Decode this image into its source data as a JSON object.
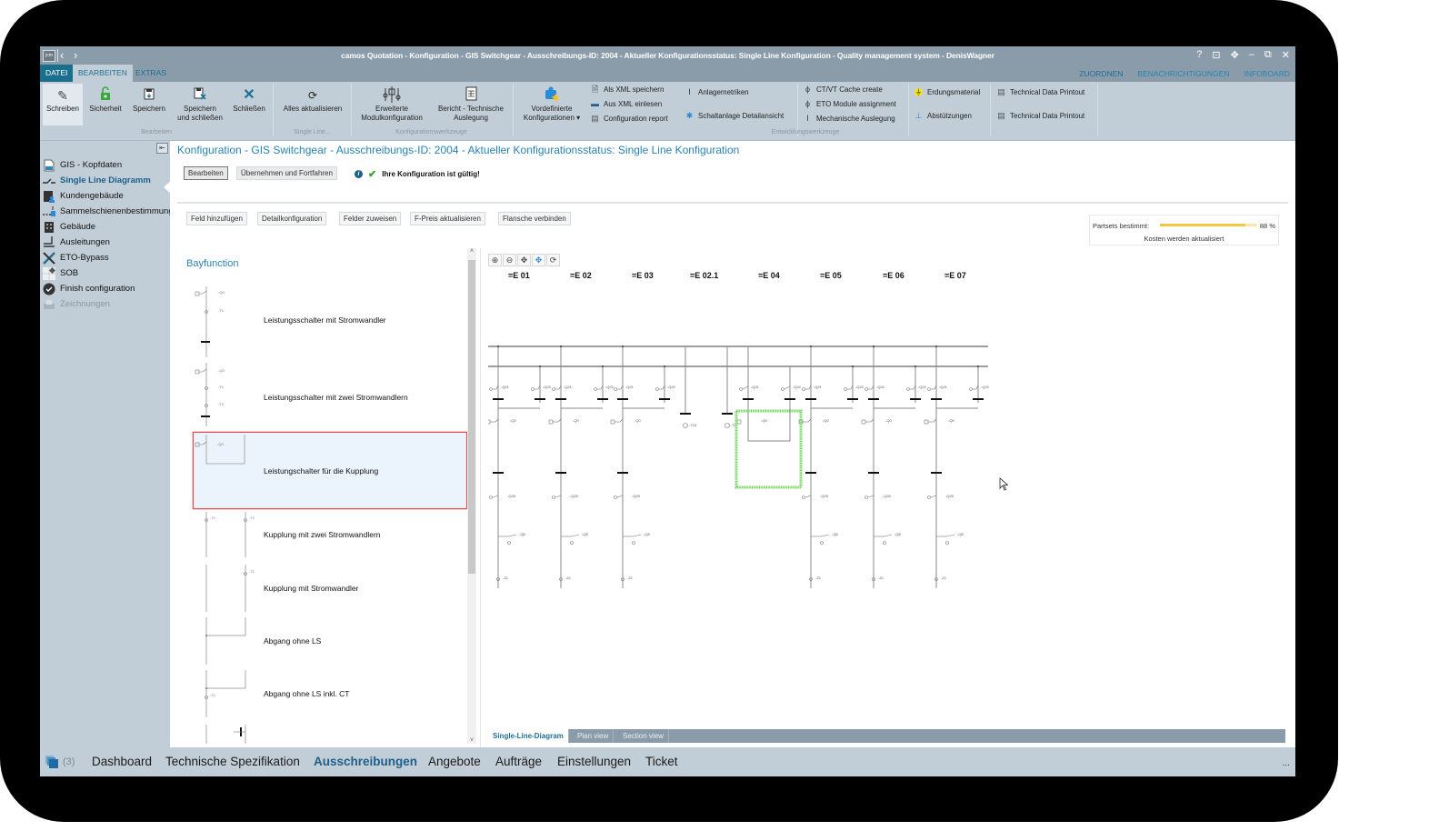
{
  "window": {
    "title": "camos Quotation   -   Konfiguration - GIS Switchgear - Ausschreibungs-ID: 2004 - Aktueller Konfigurationsstatus: Single Line Konfiguration   -   Quality management system   -   DenisWagner",
    "logo_text": "jcm",
    "controls": {
      "help": "?",
      "pin": "⊡",
      "move": "✥",
      "minimize": "‒",
      "restore": "⧉",
      "close": "✕"
    }
  },
  "menu": {
    "tabs": [
      "DATEI",
      "BEARBEITEN",
      "EXTRAS"
    ],
    "right_links": [
      "ZUORDNEN",
      "BENACHRICHTIGUNGEN",
      "INFOBOARD"
    ]
  },
  "ribbon": {
    "groups": {
      "bearbeiten": "Bearbeiten",
      "single_line": "Single Line...",
      "konfigurationswerkzeuge": "Konfigurationswerkzeuge",
      "entwicklungswerkzeuge": "Entwicklungswerkzeuge"
    },
    "schreiben": "Schreiben",
    "sicherheit": "Sicherheit",
    "speichern": "Speichern",
    "speichern_schliessen_1": "Speichern",
    "speichern_schliessen_2": "und schließen",
    "schliessen": "Schließen",
    "alles_aktualisieren": "Alles aktualisieren",
    "erweiterte_1": "Erweiterte",
    "erweiterte_2": "Modulkonfiguration",
    "bericht_1": "Bericht - Technische",
    "bericht_2": "Auslegung",
    "vordefinierte_1": "Vordefinierte",
    "vordefinierte_2": "Konfigurationen ▾",
    "als_xml": "Als XML speichern",
    "aus_xml": "Aus XML einlesen",
    "config_report": "Configuration report",
    "anlagemetriken": "Anlagemetriken",
    "schaltanlage": "Schaltanlage Detailansicht",
    "ctvt": "CT/VT Cache create",
    "eto_module": "ETO Module assignment",
    "mechanische": "Mechanische Auslegung",
    "erdungsmaterial": "Erdungsmaterial",
    "abstuetzungen": "Abstützungen",
    "tech_data_1": "Technical Data Printout",
    "tech_data_2": "Technical Data Printout"
  },
  "sidebar": {
    "items": [
      {
        "label": "GIS - Kopfdaten",
        "icon": "document-icon"
      },
      {
        "label": "Single Line Diagramm",
        "icon": "switch-icon",
        "active": true
      },
      {
        "label": "Kundengebäude",
        "icon": "customer-building-icon"
      },
      {
        "label": "Sammelschienenbestimmung",
        "icon": "busbar-icon"
      },
      {
        "label": "Gebäude",
        "icon": "building-icon"
      },
      {
        "label": "Ausleitungen",
        "icon": "outlet-icon"
      },
      {
        "label": "ETO-Bypass",
        "icon": "tools-icon"
      },
      {
        "label": "SOB",
        "icon": "sob-icon"
      },
      {
        "label": "Finish configuration",
        "icon": "check-circle-icon"
      },
      {
        "label": "Zeichnungen",
        "icon": "drawings-icon",
        "disabled": true
      }
    ]
  },
  "main": {
    "title": "Konfiguration - GIS Switchgear - Ausschreibungs-ID: 2004 - Aktueller Konfigurationsstatus:  Single Line Konfiguration",
    "edit_button": "Bearbeiten",
    "apply_button": "Übernehmen und Fortfahren",
    "valid_text": "Ihre Konfiguration ist gültig!",
    "actions": [
      "Feld hinzufügen",
      "Detailkonfiguration",
      "Felder zuweisen",
      "F-Preis aktualisieren",
      "Flansche verbinden"
    ],
    "progress": {
      "label": "Partsets bestimmt:",
      "percent": 88,
      "percent_text": "88 %",
      "status": "Kosten werden aktualisiert"
    }
  },
  "bayfunction": {
    "header": "Bayfunction",
    "items": [
      {
        "label": "Leistungsschalter mit Stromwandler"
      },
      {
        "label": "Leistungsschalter mit zwei Stromwandlern"
      },
      {
        "label": "Leistungschalter für die Kupplung",
        "selected": true
      },
      {
        "label": "Kupplung mit zwei Stromwandlern"
      },
      {
        "label": "Kupplung mit Stromwandler"
      },
      {
        "label": "Abgang ohne LS"
      },
      {
        "label": "Abgang ohne LS inkl. CT"
      }
    ]
  },
  "diagram": {
    "fields": [
      "=E 01",
      "=E 02",
      "=E 03",
      "=E 02.1",
      "=E 04",
      "=E 05",
      "=E 06",
      "=E 07"
    ],
    "tags": {
      "q21": "-Q21",
      "q22": "-Q22",
      "q0": "-Q0",
      "q29": "-Q29",
      "q8": "-Q8",
      "z1": "-Z1",
      "t15": "-T15",
      "t2": "-T2"
    },
    "highlight_color": "#6fd35a"
  },
  "view_tabs": [
    "Single-Line-Diagram",
    "Plan view",
    "Section view"
  ],
  "statusbar": {
    "count": "(3)",
    "nav": [
      "Dashboard",
      "Technische Spezifikation",
      "Ausschreibungen",
      "Angebote",
      "Aufträge",
      "Einstellungen",
      "Ticket"
    ],
    "active": "Ausschreibungen",
    "more": "..."
  }
}
